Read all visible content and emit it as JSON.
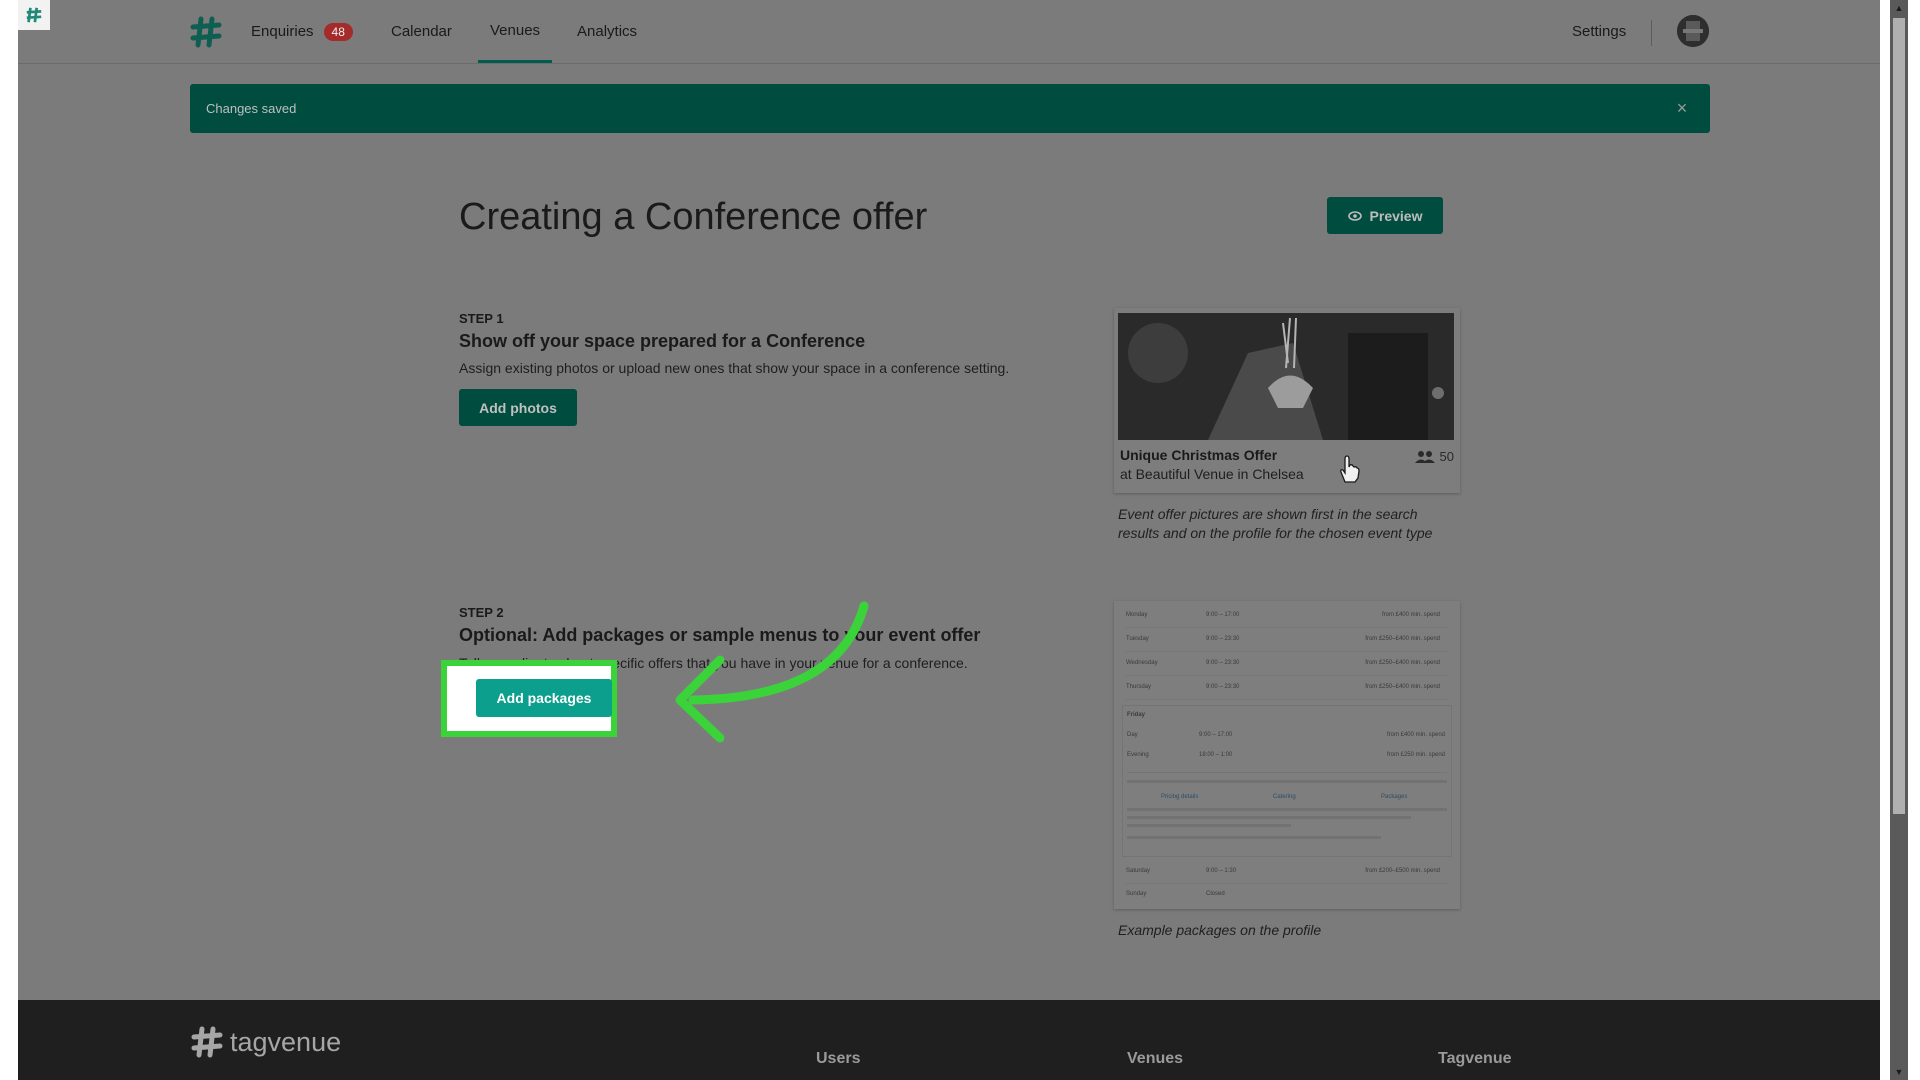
{
  "nav": {
    "enquiries_label": "Enquiries",
    "enquiries_count": "48",
    "calendar_label": "Calendar",
    "venues_label": "Venues",
    "analytics_label": "Analytics",
    "settings_label": "Settings"
  },
  "alert": {
    "message": "Changes saved",
    "close": "×"
  },
  "page": {
    "title": "Creating a Conference offer",
    "preview_label": "Preview"
  },
  "step1": {
    "label": "STEP 1",
    "title": "Show off your space prepared for a Conference",
    "description": "Assign existing photos or upload new ones that show your space in a conference setting.",
    "button": "Add photos"
  },
  "offer_card": {
    "title": "Unique Christmas Offer",
    "subtitle": "at Beautiful Venue in Chelsea",
    "capacity": "50",
    "caption_line1": "Event offer pictures are shown first in the search",
    "caption_line2": "results and on the profile for the chosen event type"
  },
  "step2": {
    "label": "STEP 2",
    "title": "Optional: Add packages or sample menus to your event offer",
    "description": "Tell your clients about specific offers that you have in your venue for a conference.",
    "button": "Add packages"
  },
  "packages_card": {
    "rows": [
      {
        "day": "Monday",
        "time": "9:00 – 17:00",
        "price": "from £400 min. spend"
      },
      {
        "day": "Tuesday",
        "time": "9:00 – 23:30",
        "price": "from £250–£400 min. spend"
      },
      {
        "day": "Wednesday",
        "time": "9:00 – 23:30",
        "price": "from £250–£400 min. spend"
      },
      {
        "day": "Thursday",
        "time": "9:00 – 23:30",
        "price": "from £250–£400 min. spend"
      }
    ],
    "friday_label": "Friday",
    "friday_rows": [
      {
        "day": "Day",
        "time": "9:00 – 17:00",
        "price": "from £400 min. spend"
      },
      {
        "day": "Evening",
        "time": "18:00 – 1:00",
        "price": "from £250 min. spend"
      }
    ],
    "tabs": [
      "Pricing details",
      "Catering",
      "Packages"
    ],
    "bottom_rows": [
      {
        "day": "Saturday",
        "time": "9:00 – 1:30",
        "price": "from £200–£500 min. spend"
      },
      {
        "day": "Sunday",
        "time": "Closed",
        "price": ""
      }
    ],
    "caption": "Example packages on the profile"
  },
  "footer": {
    "brand": "tagvenue",
    "col1": "Users",
    "col2": "Venues",
    "col3": "Tagvenue"
  },
  "colors": {
    "brand_dark": "#004d40",
    "brand_bright": "#0d9f8d",
    "highlight": "#3ad43a",
    "badge": "#a52a2a"
  }
}
